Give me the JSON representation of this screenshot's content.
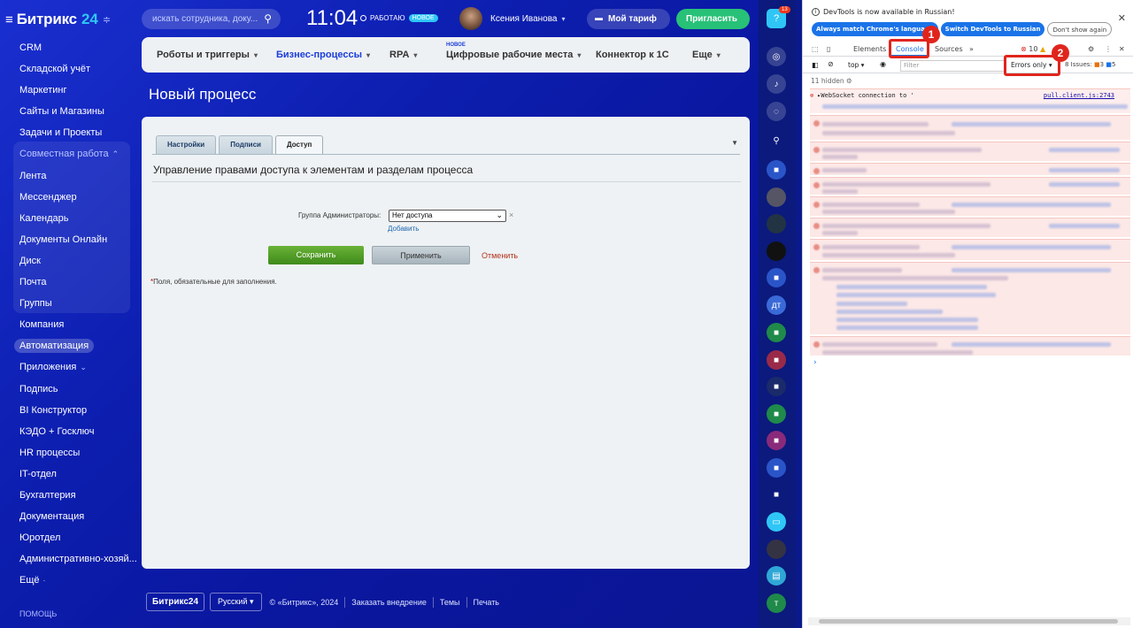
{
  "brand": {
    "name": "Битрикс",
    "num": "24"
  },
  "left_menu": {
    "items": [
      {
        "label": "CRM"
      },
      {
        "label": "Складской учёт"
      },
      {
        "label": "Маркетинг"
      },
      {
        "label": "Сайты и Магазины"
      },
      {
        "label": "Задачи и Проекты"
      },
      {
        "label": "Совместная работа"
      },
      {
        "label": "Лента"
      },
      {
        "label": "Мессенджер"
      },
      {
        "label": "Календарь"
      },
      {
        "label": "Документы Онлайн"
      },
      {
        "label": "Диск"
      },
      {
        "label": "Почта"
      },
      {
        "label": "Группы"
      },
      {
        "label": "Компания"
      },
      {
        "label": "Автоматизация"
      },
      {
        "label": "Приложения"
      },
      {
        "label": "Подпись"
      },
      {
        "label": "BI Конструктор"
      },
      {
        "label": "КЭДО + Госключ"
      },
      {
        "label": "HR процессы"
      },
      {
        "label": "IT-отдел"
      },
      {
        "label": "Бухгалтерия"
      },
      {
        "label": "Документация"
      },
      {
        "label": "Юротдел"
      },
      {
        "label": "Административно-хозяй..."
      },
      {
        "label": "Ещё"
      }
    ],
    "help": "ПОМОЩЬ"
  },
  "topbar": {
    "search_placeholder": "искать сотрудника, доку...",
    "clock": "11:04",
    "working": "РАБОТАЮ",
    "working_badge": "НОВОЕ",
    "user": "Ксения Иванова",
    "tariff": "Мой тариф",
    "invite": "Пригласить"
  },
  "nav": {
    "items": [
      {
        "label": "Роботы и триггеры"
      },
      {
        "label": "Бизнес-процессы"
      },
      {
        "label": "RPA"
      },
      {
        "label": "Цифровые рабочие места"
      },
      {
        "label": "Коннектор к 1С"
      },
      {
        "label": "Еще"
      }
    ],
    "new_tag": "НОВОЕ"
  },
  "page": {
    "title": "Новый процесс",
    "tabs": [
      {
        "label": "Настройки"
      },
      {
        "label": "Подписи"
      },
      {
        "label": "Доступ"
      }
    ],
    "section_title": "Управление правами доступа к элементам и разделам процесса",
    "field_label": "Группа Администраторы:",
    "select_value": "Нет доступа",
    "add_link": "Добавить",
    "save": "Сохранить",
    "apply": "Применить",
    "cancel": "Отменить",
    "required_note": "Поля, обязательные для заполнения.",
    "required_star": "*"
  },
  "footer": {
    "logo": "Битрикс24",
    "lang": "Русский",
    "copyright": "© «Битрикс», 2024",
    "order": "Заказать внедрение",
    "themes": "Темы",
    "print": "Печать"
  },
  "right_strip": {
    "badge": "13"
  },
  "devtools": {
    "info": "DevTools is now available in Russian!",
    "btn_match": "Always match Chrome's language",
    "btn_switch": "Switch DevTools to Russian",
    "btn_dont": "Don't show again",
    "tab_elements": "Elements",
    "tab_console": "Console",
    "tab_sources": "Sources",
    "tab_more": "»",
    "errors_count": "10",
    "context": "top",
    "filter_placeholder": "Filter",
    "levels": "Errors only",
    "issues_label": "8 Issues:",
    "issues_warn": "3",
    "issues_info": "5",
    "hidden": "11 hidden",
    "first_error": "▸WebSocket connection to '",
    "first_link": "pull.client.js:2743",
    "prompt": "›"
  },
  "callouts": {
    "one": "1",
    "two": "2"
  },
  "colors": {
    "accent": "#1a73e8",
    "callout": "#e0251d",
    "bitrix_blue": "#1a2fd0"
  }
}
